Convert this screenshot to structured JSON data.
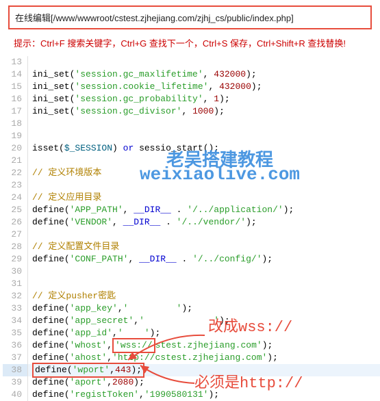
{
  "header": {
    "title": "在线编辑[/www/wwwroot/cstest.zjhejiang.com/zjhj_cs/public/index.php]"
  },
  "tip": "提示：Ctrl+F 搜索关键字，Ctrl+G 查找下一个，Ctrl+S 保存，Ctrl+Shift+R 查找替换!",
  "watermark": {
    "line1": "老吴搭建教程",
    "line2": "weixiaolive.com"
  },
  "annotations": {
    "a1": "改成wss://",
    "a2": "必须是http://"
  },
  "code": {
    "lines": [
      {
        "n": 13,
        "kind": "blank"
      },
      {
        "n": 14,
        "kind": "ini",
        "key": "session.gc_maxlifetime",
        "val": "432000"
      },
      {
        "n": 15,
        "kind": "ini",
        "key": "session.cookie_lifetime",
        "val": "432000"
      },
      {
        "n": 16,
        "kind": "ini",
        "key": "session.gc_probability",
        "val": "1"
      },
      {
        "n": 17,
        "kind": "ini",
        "key": "session.gc_divisor",
        "val": "1000"
      },
      {
        "n": 18,
        "kind": "blank"
      },
      {
        "n": 19,
        "kind": "blank"
      },
      {
        "n": 20,
        "kind": "isset",
        "var": "$_SESSION",
        "rest": "sessio_start"
      },
      {
        "n": 21,
        "kind": "blank"
      },
      {
        "n": 22,
        "kind": "cmt",
        "text": "// 定义环境版本"
      },
      {
        "n": 23,
        "kind": "blank"
      },
      {
        "n": 24,
        "kind": "cmt",
        "text": "// 定义应用目录"
      },
      {
        "n": 25,
        "kind": "defineDir",
        "name": "APP_PATH",
        "path": "/../application/"
      },
      {
        "n": 26,
        "kind": "defineDir",
        "name": "VENDOR",
        "path": "/../vendor/"
      },
      {
        "n": 27,
        "kind": "blank"
      },
      {
        "n": 28,
        "kind": "cmt",
        "text": "// 定义配置文件目录"
      },
      {
        "n": 29,
        "kind": "defineDir",
        "name": "CONF_PATH",
        "path": "/../config/"
      },
      {
        "n": 30,
        "kind": "blank"
      },
      {
        "n": 31,
        "kind": "blank"
      },
      {
        "n": 32,
        "kind": "cmt",
        "text": "// 定义pusher密匙"
      },
      {
        "n": 33,
        "kind": "defStr",
        "name": "app_key",
        "val": "         "
      },
      {
        "n": 34,
        "kind": "defStr",
        "name": "app_secret",
        "val": "             "
      },
      {
        "n": 35,
        "kind": "defStr",
        "name": "app_id",
        "val": "    "
      },
      {
        "n": 36,
        "kind": "defUrl",
        "name": "whost",
        "proto": "wss://",
        "host": "stest.zjhejiang.com",
        "hl": true
      },
      {
        "n": 37,
        "kind": "defUrl",
        "name": "ahost",
        "proto": "http://",
        "host": "cstest.zjhejiang.com",
        "hl": false
      },
      {
        "n": 38,
        "kind": "defNum",
        "name": "wport",
        "val": "443",
        "hlRow": true,
        "active": true
      },
      {
        "n": 39,
        "kind": "defNum",
        "name": "aport",
        "val": "2080"
      },
      {
        "n": 40,
        "kind": "defStr",
        "name": "registToken",
        "val": "1990580131"
      }
    ]
  }
}
